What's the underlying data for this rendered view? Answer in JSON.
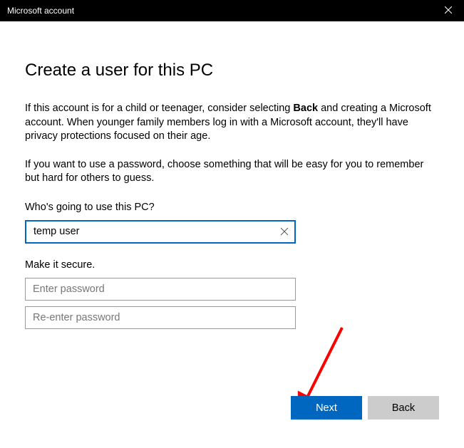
{
  "titlebar": {
    "title": "Microsoft account"
  },
  "heading": "Create a user for this PC",
  "paragraph1_pre": "If this account is for a child or teenager, consider selecting ",
  "paragraph1_bold": "Back",
  "paragraph1_post": " and creating a Microsoft account. When younger family members log in with a Microsoft account, they'll have privacy protections focused on their age.",
  "paragraph2": "If you want to use a password, choose something that will be easy for you to remember but hard for others to guess.",
  "username": {
    "label": "Who's going to use this PC?",
    "value": "temp user"
  },
  "secure_label": "Make it secure.",
  "password": {
    "placeholder": "Enter password"
  },
  "password_confirm": {
    "placeholder": "Re-enter password"
  },
  "buttons": {
    "next": "Next",
    "back": "Back"
  }
}
